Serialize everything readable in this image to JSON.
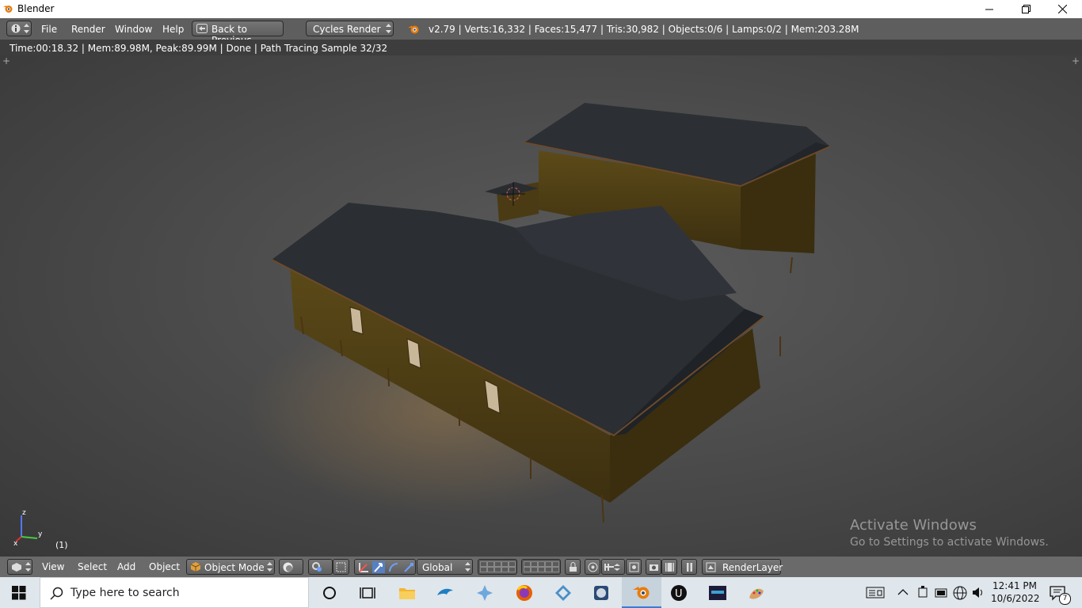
{
  "window": {
    "title": "Blender"
  },
  "info_header": {
    "menus": [
      "File",
      "Render",
      "Window",
      "Help"
    ],
    "back_button": "Back to Previous",
    "engine": "Cycles Render",
    "stats": "v2.79 | Verts:16,332 | Faces:15,477 | Tris:30,982 | Objects:0/6 | Lamps:0/2 | Mem:203.28M"
  },
  "render_status": "Time:00:18.32 | Mem:89.98M, Peak:89.99M | Done | Path Tracing Sample 32/32",
  "viewport": {
    "frame_label": "(1)",
    "axis_labels": {
      "x": "x",
      "y": "y",
      "z": "z"
    },
    "watermark_title": "Activate Windows",
    "watermark_sub": "Go to Settings to activate Windows."
  },
  "view3d_header": {
    "menus": [
      "View",
      "Select",
      "Add",
      "Object"
    ],
    "mode": "Object Mode",
    "orientation": "Global",
    "render_layer": "RenderLayer"
  },
  "taskbar": {
    "search_placeholder": "Type here to search",
    "time": "12:41 PM",
    "date": "10/6/2022",
    "notification_count": "7"
  },
  "colors": {
    "blender_orange": "#e87d0d",
    "header_bg": "#5e5e5e",
    "viewport_bg": "#4c4c4c",
    "taskbar_bg": "#dfe6ec"
  }
}
